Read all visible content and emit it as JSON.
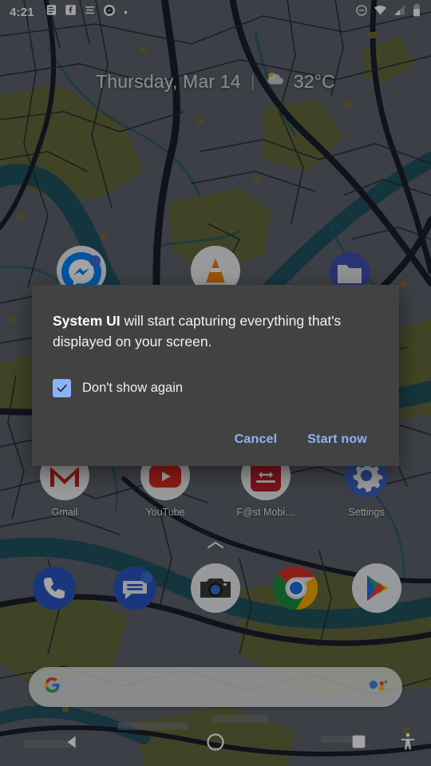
{
  "status_bar": {
    "time": "4:21",
    "left_icons": [
      {
        "name": "notes-notification-icon",
        "glyph": "notes"
      },
      {
        "name": "facebook-notification-icon",
        "glyph": "facebook"
      },
      {
        "name": "menu-lines-notification-icon",
        "glyph": "lines"
      },
      {
        "name": "messenger-notification-icon",
        "glyph": "messenger"
      },
      {
        "name": "more-notifications-dot-icon",
        "glyph": "dot"
      }
    ],
    "right_icons": [
      {
        "name": "do-not-disturb-icon",
        "glyph": "dnd"
      },
      {
        "name": "wifi-icon",
        "glyph": "wifi",
        "level": "full"
      },
      {
        "name": "cellular-signal-icon",
        "glyph": "signal",
        "level": "half"
      },
      {
        "name": "battery-icon",
        "glyph": "battery",
        "level": "60%"
      }
    ]
  },
  "date_widget": {
    "date": "Thursday, Mar 14",
    "divider": "|",
    "weather_icon": "partly-cloudy-icon",
    "temperature": "32°C"
  },
  "home": {
    "row_top": [
      {
        "label": "",
        "icon": "messenger-app-icon"
      },
      {
        "label": "",
        "icon": "vlc-app-icon"
      },
      {
        "label": "",
        "icon": "files-app-icon"
      }
    ],
    "row_mid": [
      {
        "label": "Gmail",
        "icon": "gmail-app-icon"
      },
      {
        "label": "YouTube",
        "icon": "youtube-app-icon"
      },
      {
        "label": "F@st Mobi…",
        "icon": "techcombank-app-icon"
      },
      {
        "label": "Settings",
        "icon": "settings-app-icon"
      }
    ],
    "dock": [
      {
        "label": "",
        "icon": "phone-app-icon"
      },
      {
        "label": "",
        "icon": "messages-app-icon"
      },
      {
        "label": "",
        "icon": "camera-app-icon"
      },
      {
        "label": "",
        "icon": "chrome-app-icon"
      },
      {
        "label": "",
        "icon": "play-store-app-icon"
      }
    ],
    "drawer_handle": "app-drawer-chevron-icon"
  },
  "search_bar": {
    "logo": "google-g-logo-icon",
    "placeholder": "",
    "value": "",
    "assistant_icon": "google-assistant-icon"
  },
  "nav_bar": {
    "back": "back-triangle-icon",
    "home": "home-circle-icon",
    "recents": "recents-square-icon",
    "accessibility": "accessibility-person-icon"
  },
  "dialog": {
    "app_name": "System UI",
    "message_rest": " will start capturing everything that's displayed on your screen.",
    "checkbox_label": "Don't show again",
    "checkbox_checked": true,
    "cancel_label": "Cancel",
    "confirm_label": "Start now",
    "accent_color": "#8ab4f8",
    "background_color": "#424242"
  }
}
